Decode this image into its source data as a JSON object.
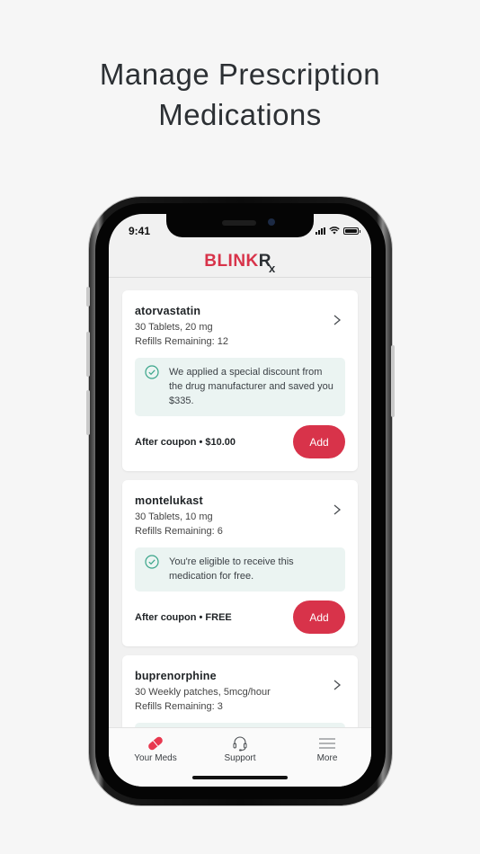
{
  "headline": {
    "line1": "Manage Prescription",
    "line2": "Medications"
  },
  "status_bar": {
    "time": "9:41"
  },
  "app": {
    "logo_main": "BLINK",
    "logo_rx_r": "R",
    "logo_rx_x": "x",
    "brand_color": "#d8334a"
  },
  "medications": [
    {
      "name": "atorvastatin",
      "quantity": "30 Tablets, 20 mg",
      "refills": "Refills Remaining: 12",
      "notice": "We applied a special discount from the drug manufacturer and saved you $335.",
      "price": "After coupon • $10.00",
      "button": "Add"
    },
    {
      "name": "montelukast",
      "quantity": "30 Tablets, 10 mg",
      "refills": "Refills Remaining: 6",
      "notice": "You're eligible to receive this medication for free.",
      "price": "After coupon • FREE",
      "button": "Add"
    },
    {
      "name": "buprenorphine",
      "quantity": "30 Weekly patches, 5mcg/hour",
      "refills": "Refills Remaining: 3"
    }
  ],
  "tabbar": {
    "items": [
      {
        "label": "Your Meds",
        "icon": "pill-icon",
        "active": true
      },
      {
        "label": "Support",
        "icon": "headset-icon",
        "active": false
      },
      {
        "label": "More",
        "icon": "menu-icon",
        "active": false
      }
    ]
  }
}
